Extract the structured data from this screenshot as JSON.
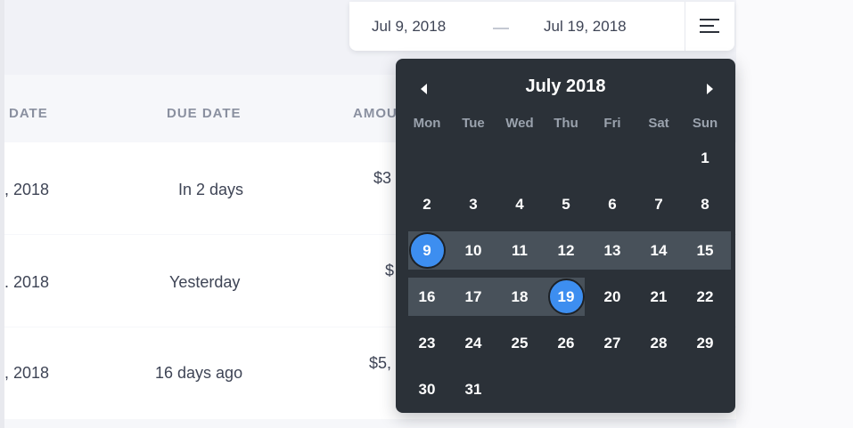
{
  "date_range": {
    "start": "Jul 9, 2018",
    "end": "Jul 19, 2018"
  },
  "table": {
    "columns": [
      "DATE",
      "DUE DATE",
      "AMOU"
    ],
    "rows": [
      {
        "date": ", 2018",
        "due": "In 2 days",
        "amount": "$3"
      },
      {
        "date": ". 2018",
        "due": "Yesterday",
        "amount": "$"
      },
      {
        "date": ", 2018",
        "due": "16 days ago",
        "amount": "$5,"
      }
    ]
  },
  "calendar": {
    "month_label": "July 2018",
    "weekdays": [
      "Mon",
      "Tue",
      "Wed",
      "Thu",
      "Fri",
      "Sat",
      "Sun"
    ],
    "first_weekday_index": 6,
    "days_in_month": 31,
    "range_start_day": 9,
    "range_end_day": 19,
    "colors": {
      "selected": "#3d8ef0",
      "in_range": "#48515a",
      "background": "#2b3138"
    },
    "icons": {
      "prev": "triangle-left-icon",
      "next": "triangle-right-icon",
      "menu": "hamburger-menu-icon"
    }
  }
}
